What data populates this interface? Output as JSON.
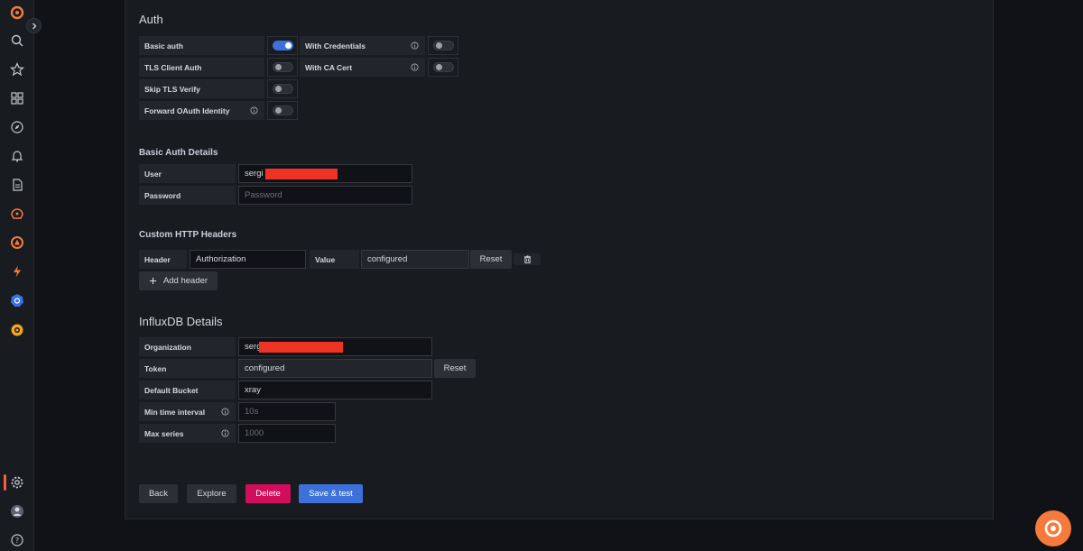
{
  "auth": {
    "title": "Auth",
    "basic_auth": "Basic auth",
    "with_credentials": "With Credentials",
    "tls_client_auth": "TLS Client Auth",
    "with_ca_cert": "With CA Cert",
    "skip_tls_verify": "Skip TLS Verify",
    "forward_oauth": "Forward OAuth Identity"
  },
  "basic_auth_details": {
    "title": "Basic Auth Details",
    "user_label": "User",
    "user_value": "sergi",
    "password_label": "Password",
    "password_placeholder": "Password"
  },
  "custom_headers": {
    "title": "Custom HTTP Headers",
    "header_label": "Header",
    "header_value": "Authorization",
    "value_label": "Value",
    "value_value": "configured",
    "reset": "Reset",
    "add_header": "Add header"
  },
  "influxdb": {
    "title": "InfluxDB Details",
    "organization_label": "Organization",
    "organization_value": "serg",
    "token_label": "Token",
    "token_value": "configured",
    "token_reset": "Reset",
    "default_bucket_label": "Default Bucket",
    "default_bucket_value": "xray",
    "min_time_label": "Min time interval",
    "min_time_placeholder": "10s",
    "max_series_label": "Max series",
    "max_series_placeholder": "1000"
  },
  "actions": {
    "back": "Back",
    "explore": "Explore",
    "delete": "Delete",
    "save_test": "Save & test"
  },
  "colors": {
    "accent": "#3d71d9",
    "danger": "#d10e5c",
    "brand": "#f55f3e"
  }
}
